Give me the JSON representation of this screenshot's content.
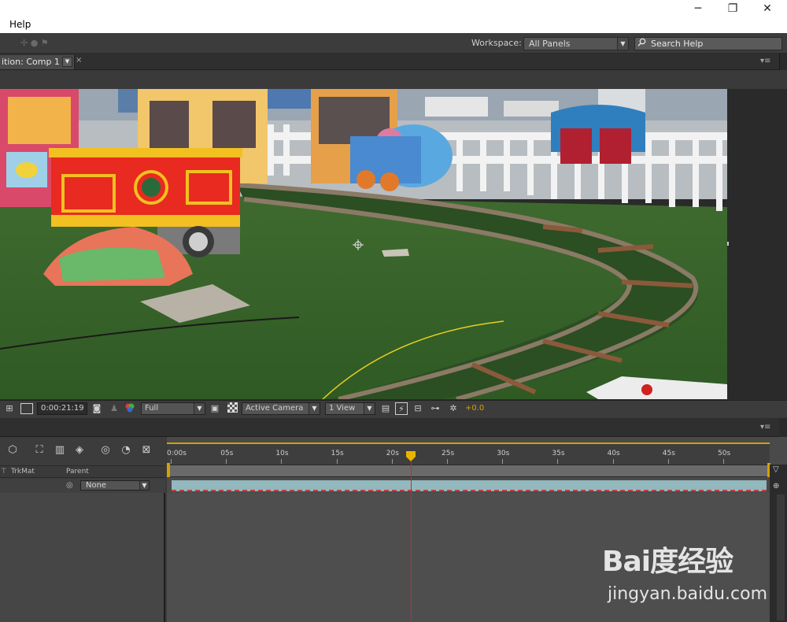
{
  "menubar": {
    "help": "Help"
  },
  "window_controls": {
    "minimize": "─",
    "restore": "❐",
    "close": "✕"
  },
  "toolbar": {
    "workspace_label": "Workspace:",
    "workspace_value": "All Panels",
    "search_value": "Search Help"
  },
  "composition_panel": {
    "tab_label": "ition: Comp 1",
    "close": "×",
    "menu": "▾≡"
  },
  "viewer_controls": {
    "timecode": "0:00:21:19",
    "resolution": "Full",
    "camera": "Active Camera",
    "views": "1 View",
    "exposure": "+0.0"
  },
  "timeline": {
    "menu": "▾≡",
    "columns": {
      "trkmat": "TrkMat",
      "parent": "Parent"
    },
    "layer_parent": "None",
    "ruler_labels": [
      "0:00s",
      "05s",
      "10s",
      "15s",
      "20s",
      "25s",
      "30s",
      "35s",
      "40s",
      "45s",
      "50s"
    ],
    "playhead_seconds": 21.8
  },
  "watermark": {
    "logo": "Bai度经验",
    "url": "jingyan.baidu.com"
  },
  "colors": {
    "playhead": "#e02020",
    "workarea": "#d4a100",
    "layer_bar": "#93b8bd"
  }
}
